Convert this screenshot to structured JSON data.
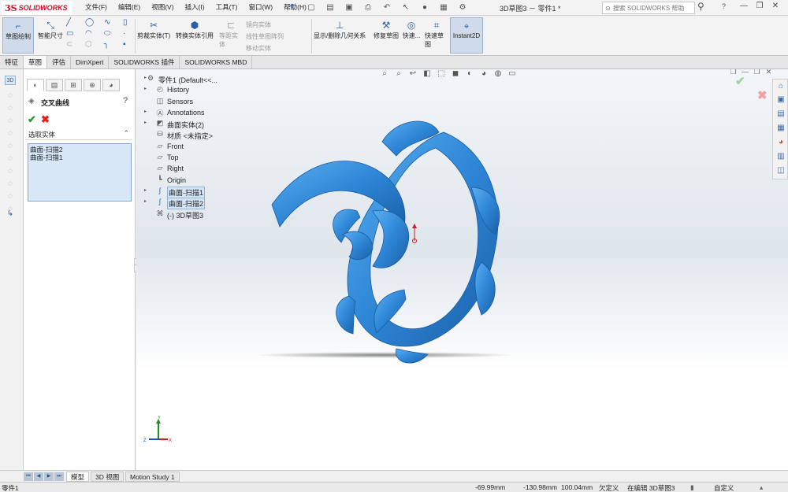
{
  "app": {
    "logo_prefix": "3S",
    "logo_name": "SOLIDWORKS",
    "doc_title": "3D草图3 － 零件1 *"
  },
  "menu": [
    "文件(F)",
    "编辑(E)",
    "视图(V)",
    "插入(I)",
    "工具(T)",
    "窗口(W)",
    "帮助(H)"
  ],
  "search": {
    "placeholder": "搜索 SOLIDWORKS 帮助"
  },
  "toolbar": {
    "sketch": "草图绘制",
    "smart_dim": "智能尺寸",
    "trim": "剪裁实体(T)",
    "convert": "转换实体引用",
    "offset": "等距实体",
    "mirror": "镜向实体",
    "linear_pattern": "线性草图阵列",
    "move": "移动实体",
    "relations": "显示/删除几何关系",
    "repair": "修复草图",
    "quick_snaps": "快速...",
    "rapid_sketch": "快速草图",
    "instant2d": "Instant2D"
  },
  "tabs": [
    "特征",
    "草图",
    "评估",
    "DimXpert",
    "SOLIDWORKS 插件",
    "SOLIDWORKS MBD"
  ],
  "active_tab": "草图",
  "property_manager": {
    "title": "交叉曲线",
    "section": "选取实体",
    "selections": [
      "曲面-扫描2",
      "曲面-扫描1"
    ]
  },
  "tree": {
    "root": "零件1  (Default<<...",
    "items": [
      "History",
      "Sensors",
      "Annotations",
      "曲面实体(2)",
      "材质 <未指定>",
      "Front",
      "Top",
      "Right",
      "Origin",
      "曲面-扫描1",
      "曲面-扫描2",
      "(-) 3D草图3"
    ]
  },
  "bottom_tabs": [
    "模型",
    "3D 视图",
    "Motion Study 1"
  ],
  "status": {
    "doc": "零件1",
    "x": "-69.99mm",
    "y": "-130.98mm",
    "z": "100.04mm",
    "state": "欠定义",
    "editing": "在编辑 3D草图3",
    "units": "自定义"
  },
  "colors": {
    "model_blue": "#2e86d6",
    "accent_red": "#c8102e",
    "ok_green": "#2e9a2e"
  }
}
